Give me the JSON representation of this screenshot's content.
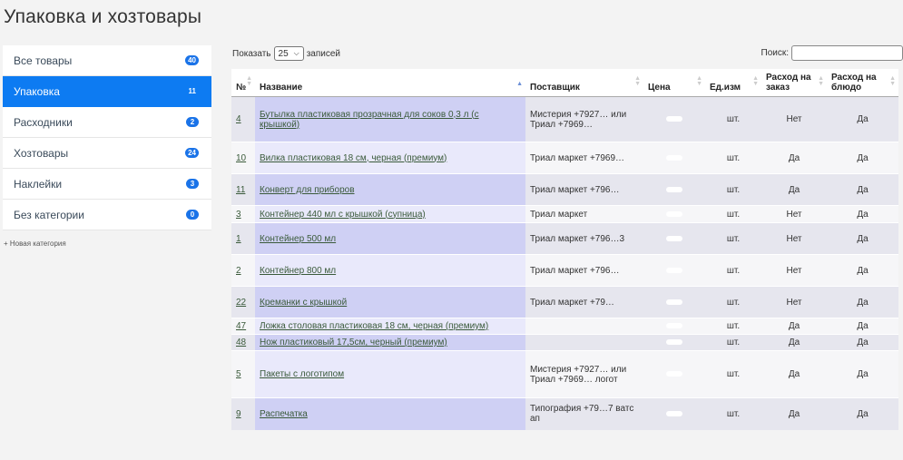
{
  "title": "Упаковка и хозтовары",
  "sidebar": {
    "categories": [
      {
        "label": "Все товары",
        "count": "40"
      },
      {
        "label": "Упаковка",
        "count": "11"
      },
      {
        "label": "Расходники",
        "count": "2"
      },
      {
        "label": "Хозтовары",
        "count": "24"
      },
      {
        "label": "Наклейки",
        "count": "3"
      },
      {
        "label": "Без категории",
        "count": "0"
      }
    ],
    "new_category": "+ Новая категория"
  },
  "controls": {
    "show_prefix": "Показать",
    "page_length": "25",
    "show_suffix": "записей",
    "search_label": "Поиск:",
    "search_value": ""
  },
  "table": {
    "headers": [
      "№",
      "Название",
      "Поставщик",
      "Цена",
      "Ед.изм",
      "Расход на заказ",
      "Расход на блюдо"
    ],
    "rows": [
      {
        "num": "4",
        "name": "Бутылка пластиковая прозрачная для соков 0,3 л (с крышкой)",
        "supplier": "Мистерия +7927… или Триал +7969…",
        "unit": "шт.",
        "per_order": "Нет",
        "per_dish": "Да"
      },
      {
        "num": "10",
        "name": "Вилка пластиковая 18 см, черная (премиум)",
        "supplier": "Триал маркет +7969…",
        "unit": "шт.",
        "per_order": "Да",
        "per_dish": "Да"
      },
      {
        "num": "11",
        "name": "Конверт для приборов",
        "supplier": "Триал маркет +796…",
        "unit": "шт.",
        "per_order": "Да",
        "per_dish": "Да"
      },
      {
        "num": "3",
        "name": "Контейнер 440 мл с крышкой (супница)",
        "supplier": "Триал маркет",
        "unit": "шт.",
        "per_order": "Нет",
        "per_dish": "Да"
      },
      {
        "num": "1",
        "name": "Контейнер 500 мл",
        "supplier": "Триал маркет +796…3",
        "unit": "шт.",
        "per_order": "Нет",
        "per_dish": "Да"
      },
      {
        "num": "2",
        "name": "Контейнер 800 мл",
        "supplier": "Триал маркет +796…",
        "unit": "шт.",
        "per_order": "Нет",
        "per_dish": "Да"
      },
      {
        "num": "22",
        "name": "Креманки с крышкой",
        "supplier": "Триал маркет +79…",
        "unit": "шт.",
        "per_order": "Нет",
        "per_dish": "Да"
      },
      {
        "num": "47",
        "name": "Ложка столовая пластиковая 18 см, черная (премиум)",
        "supplier": "",
        "unit": "шт.",
        "per_order": "Да",
        "per_dish": "Да"
      },
      {
        "num": "48",
        "name": "Нож пластиковый 17,5см, черный (премиум)",
        "supplier": "",
        "unit": "шт.",
        "per_order": "Да",
        "per_dish": "Да"
      },
      {
        "num": "5",
        "name": "Пакеты с логотипом",
        "supplier": "Мистерия +7927… или Триал +7969… логот",
        "unit": "шт.",
        "per_order": "Да",
        "per_dish": "Да"
      },
      {
        "num": "9",
        "name": "Распечатка",
        "supplier": "Типография +79…7 ватс ап",
        "unit": "шт.",
        "per_order": "Да",
        "per_dish": "Да"
      }
    ]
  }
}
